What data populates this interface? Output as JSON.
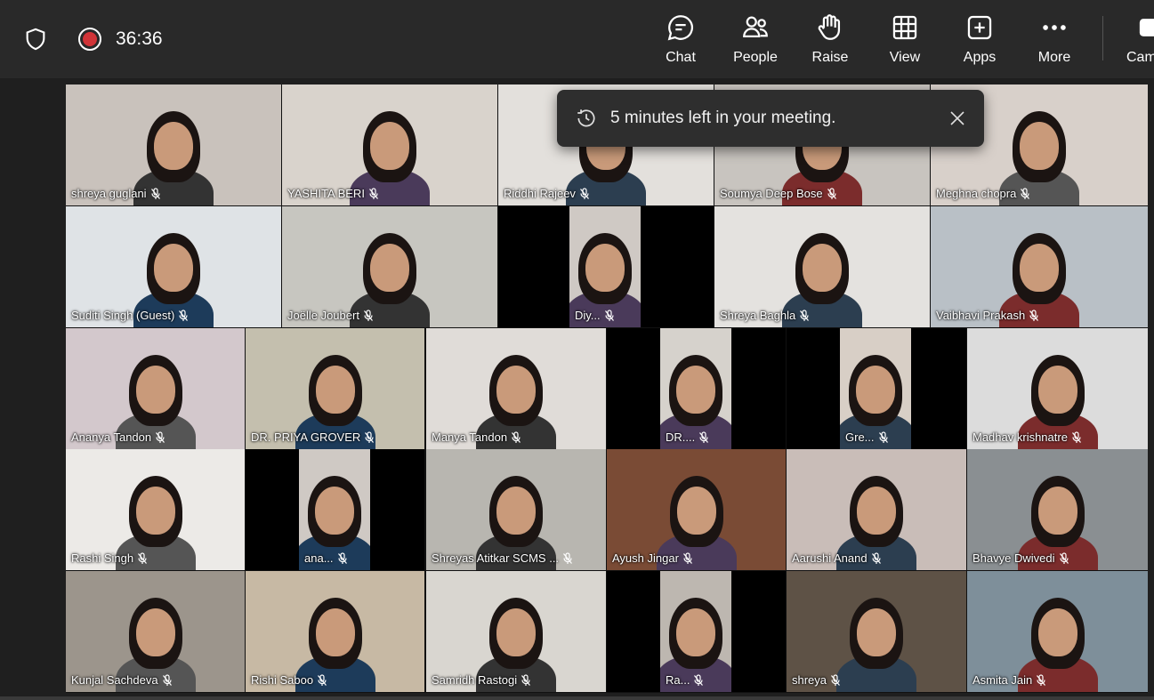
{
  "header": {
    "timer": "36:36",
    "tools": [
      {
        "id": "chat",
        "label": "Chat",
        "icon": "chat-icon"
      },
      {
        "id": "people",
        "label": "People",
        "icon": "people-icon"
      },
      {
        "id": "raise",
        "label": "Raise",
        "icon": "raise-hand-icon"
      },
      {
        "id": "view",
        "label": "View",
        "icon": "grid-view-icon"
      },
      {
        "id": "apps",
        "label": "Apps",
        "icon": "apps-plus-icon"
      },
      {
        "id": "more",
        "label": "More",
        "icon": "more-dots-icon"
      },
      {
        "id": "camera",
        "label": "Cam",
        "icon": "camera-icon"
      }
    ],
    "record_color": "#d13438"
  },
  "notification": {
    "message": "5 minutes left in your meeting."
  },
  "participants": [
    "shreya guglani",
    "YASHITA BERI",
    "Riddhi Rajeev",
    "Soumya Deep Bose",
    "Meghna chopra",
    "Suditi Singh (Guest)",
    "Joëlle Joubert",
    "Diy...",
    "Shreya Baghla",
    "Vaibhavi Prakash",
    "Ananya Tandon",
    "DR. PRIYA  GROVER",
    "Manya Tandon",
    "DR....",
    "Gre...",
    "Madhav krishnatre",
    "Rashi Singh",
    "ana...",
    "Shreyas Atitkar SCMS ...",
    "Ayush Jingar",
    "Aarushi Anand",
    "Bhavye Dwivedi",
    "Kunjal Sachdeva",
    "Rishi Saboo",
    "Samridh Rastogi",
    "Ra...",
    "shreya",
    "Asmita Jain"
  ]
}
